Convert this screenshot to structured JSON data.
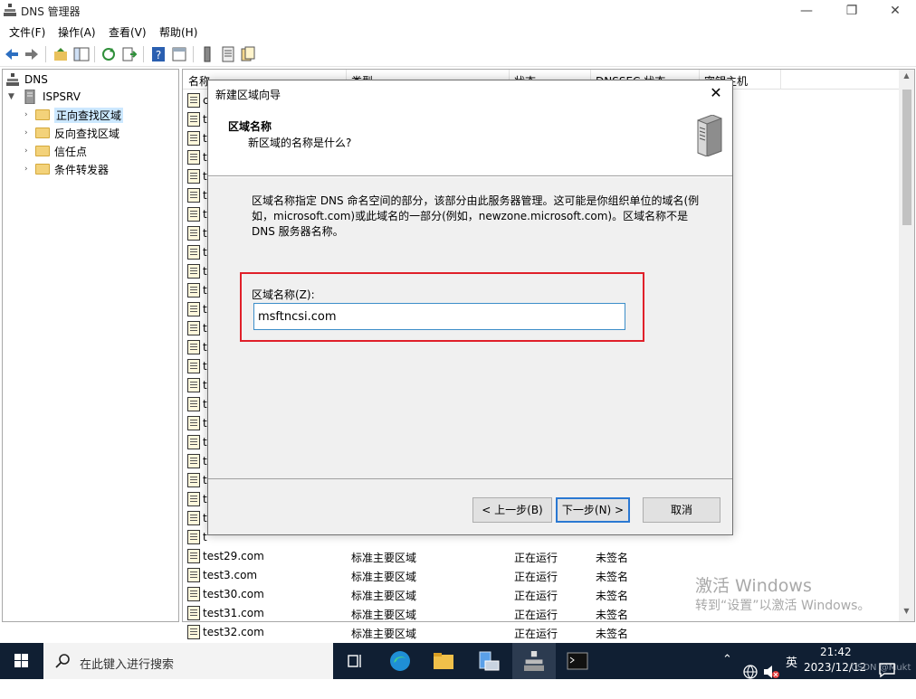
{
  "window": {
    "title": "DNS 管理器",
    "minimize": "—",
    "maximize": "❐",
    "close": "✕"
  },
  "menu": [
    "文件(F)",
    "操作(A)",
    "查看(V)",
    "帮助(H)"
  ],
  "tree": {
    "root": "DNS",
    "server": "ISPSRV",
    "children": [
      "正向查找区域",
      "反向查找区域",
      "信任点",
      "条件转发器"
    ],
    "selected": "正向查找区域"
  },
  "list": {
    "columns": [
      "名称",
      "类型",
      "状态",
      "DNSSEC 状态",
      "密钥主机"
    ],
    "rows": [
      {
        "name": "c",
        "type": "",
        "status": "",
        "dnssec": ""
      },
      {
        "name": "t",
        "type": "",
        "status": "",
        "dnssec": ""
      },
      {
        "name": "t",
        "type": "",
        "status": "",
        "dnssec": ""
      },
      {
        "name": "t",
        "type": "",
        "status": "",
        "dnssec": ""
      },
      {
        "name": "t",
        "type": "",
        "status": "",
        "dnssec": ""
      },
      {
        "name": "t",
        "type": "",
        "status": "",
        "dnssec": ""
      },
      {
        "name": "t",
        "type": "",
        "status": "",
        "dnssec": ""
      },
      {
        "name": "t",
        "type": "",
        "status": "",
        "dnssec": ""
      },
      {
        "name": "t",
        "type": "",
        "status": "",
        "dnssec": ""
      },
      {
        "name": "t",
        "type": "",
        "status": "",
        "dnssec": ""
      },
      {
        "name": "t",
        "type": "",
        "status": "",
        "dnssec": ""
      },
      {
        "name": "t",
        "type": "",
        "status": "",
        "dnssec": ""
      },
      {
        "name": "t",
        "type": "",
        "status": "",
        "dnssec": ""
      },
      {
        "name": "t",
        "type": "",
        "status": "",
        "dnssec": ""
      },
      {
        "name": "t",
        "type": "",
        "status": "",
        "dnssec": ""
      },
      {
        "name": "t",
        "type": "",
        "status": "",
        "dnssec": ""
      },
      {
        "name": "t",
        "type": "",
        "status": "",
        "dnssec": ""
      },
      {
        "name": "t",
        "type": "",
        "status": "",
        "dnssec": ""
      },
      {
        "name": "t",
        "type": "",
        "status": "",
        "dnssec": ""
      },
      {
        "name": "t",
        "type": "",
        "status": "",
        "dnssec": ""
      },
      {
        "name": "t",
        "type": "",
        "status": "",
        "dnssec": ""
      },
      {
        "name": "t",
        "type": "",
        "status": "",
        "dnssec": ""
      },
      {
        "name": "t",
        "type": "",
        "status": "",
        "dnssec": ""
      },
      {
        "name": "t",
        "type": "",
        "status": "",
        "dnssec": ""
      },
      {
        "name": "test29.com",
        "type": "标准主要区域",
        "status": "正在运行",
        "dnssec": "未签名"
      },
      {
        "name": "test3.com",
        "type": "标准主要区域",
        "status": "正在运行",
        "dnssec": "未签名"
      },
      {
        "name": "test30.com",
        "type": "标准主要区域",
        "status": "正在运行",
        "dnssec": "未签名"
      },
      {
        "name": "test31.com",
        "type": "标准主要区域",
        "status": "正在运行",
        "dnssec": "未签名"
      },
      {
        "name": "test32.com",
        "type": "标准主要区域",
        "status": "正在运行",
        "dnssec": "未签名"
      }
    ]
  },
  "dialog": {
    "title": "新建区域向导",
    "header_title": "区域名称",
    "header_subtitle": "新区域的名称是什么?",
    "description": "区域名称指定 DNS 命名空间的部分，该部分由此服务器管理。这可能是你组织单位的域名(例如，microsoft.com)或此域名的一部分(例如，newzone.microsoft.com)。区域名称不是 DNS 服务器名称。",
    "zone_label": "区域名称(Z):",
    "zone_value": "msftncsi.com",
    "back": "< 上一步(B)",
    "next": "下一步(N) >",
    "cancel": "取消"
  },
  "watermark": {
    "line1": "激活 Windows",
    "line2": "转到“设置”以激活 Windows。"
  },
  "taskbar": {
    "search_placeholder": "在此键入进行搜索",
    "time": "21:42",
    "date": "2023/12/12",
    "ime": "英",
    "credit": "CSDN @Mukt"
  }
}
